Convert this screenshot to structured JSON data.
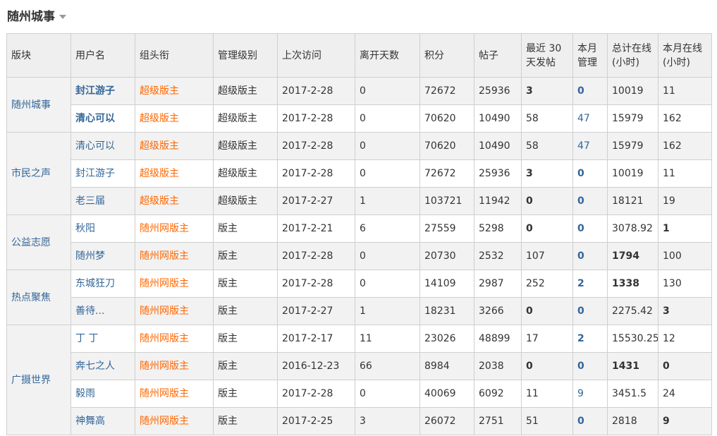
{
  "page": {
    "title": "随州城事"
  },
  "table": {
    "headers": [
      "版块",
      "用户名",
      "组头衔",
      "管理级别",
      "上次访问",
      "离开天数",
      "积分",
      "帖子",
      "最近 30 天发帖",
      "本月管理",
      "总计在线(小时)",
      "本月在线(小时)"
    ],
    "header_lines": [
      [
        "版块"
      ],
      [
        "用户名"
      ],
      [
        "组头衔"
      ],
      [
        "管理级别"
      ],
      [
        "上次访问"
      ],
      [
        "离开天数"
      ],
      [
        "积分"
      ],
      [
        "帖子"
      ],
      [
        "最近 30",
        "天发帖"
      ],
      [
        "本月",
        "管理"
      ],
      [
        "总计在线",
        "(小时)"
      ],
      [
        "本月在线",
        "(小时)"
      ]
    ],
    "groups": [
      {
        "forum": "随州城事",
        "rows": [
          {
            "user": "封江游子",
            "user_bold": true,
            "title": "超级版主",
            "level": "超级版主",
            "last": "2017-2-28",
            "away": "0",
            "points": "72672",
            "posts": "25936",
            "recent": "3",
            "recent_bold": true,
            "manage": "0",
            "manage_bold": true,
            "total": "10019",
            "total_bold": false,
            "month": "11",
            "month_bold": false
          },
          {
            "user": "清心可以",
            "user_bold": true,
            "title": "超级版主",
            "level": "超级版主",
            "last": "2017-2-28",
            "away": "0",
            "points": "70620",
            "posts": "10490",
            "recent": "58",
            "recent_bold": false,
            "manage": "47",
            "manage_bold": false,
            "total": "15979",
            "total_bold": false,
            "month": "162",
            "month_bold": false
          }
        ]
      },
      {
        "forum": "市民之声",
        "rows": [
          {
            "user": "清心可以",
            "user_bold": false,
            "title": "超级版主",
            "level": "超级版主",
            "last": "2017-2-28",
            "away": "0",
            "points": "70620",
            "posts": "10490",
            "recent": "58",
            "recent_bold": false,
            "manage": "47",
            "manage_bold": false,
            "total": "15979",
            "total_bold": false,
            "month": "162",
            "month_bold": false
          },
          {
            "user": "封江游子",
            "user_bold": false,
            "title": "超级版主",
            "level": "超级版主",
            "last": "2017-2-28",
            "away": "0",
            "points": "72672",
            "posts": "25936",
            "recent": "3",
            "recent_bold": true,
            "manage": "0",
            "manage_bold": true,
            "total": "10019",
            "total_bold": false,
            "month": "11",
            "month_bold": false
          },
          {
            "user": "老三届",
            "user_bold": false,
            "title": "超级版主",
            "level": "超级版主",
            "last": "2017-2-27",
            "away": "1",
            "points": "103721",
            "posts": "11942",
            "recent": "0",
            "recent_bold": true,
            "manage": "0",
            "manage_bold": true,
            "total": "18121",
            "total_bold": false,
            "month": "19",
            "month_bold": false
          }
        ]
      },
      {
        "forum": "公益志愿",
        "rows": [
          {
            "user": "秋阳",
            "user_bold": false,
            "title": "随州网版主",
            "level": "版主",
            "last": "2017-2-21",
            "away": "6",
            "points": "27559",
            "posts": "5298",
            "recent": "0",
            "recent_bold": true,
            "manage": "0",
            "manage_bold": true,
            "total": "3078.92",
            "total_bold": false,
            "month": "1",
            "month_bold": true
          },
          {
            "user": "随州梦",
            "user_bold": false,
            "title": "随州网版主",
            "level": "版主",
            "last": "2017-2-28",
            "away": "0",
            "points": "20730",
            "posts": "2532",
            "recent": "107",
            "recent_bold": false,
            "manage": "0",
            "manage_bold": true,
            "total": "1794",
            "total_bold": true,
            "month": "100",
            "month_bold": false
          }
        ]
      },
      {
        "forum": "热点聚焦",
        "rows": [
          {
            "user": "东城狂刀",
            "user_bold": false,
            "title": "随州网版主",
            "level": "版主",
            "last": "2017-2-28",
            "away": "0",
            "points": "14109",
            "posts": "2987",
            "recent": "252",
            "recent_bold": false,
            "manage": "2",
            "manage_bold": true,
            "total": "1338",
            "total_bold": true,
            "month": "130",
            "month_bold": false
          },
          {
            "user": "善待...",
            "user_bold": false,
            "title": "随州网版主",
            "level": "版主",
            "last": "2017-2-27",
            "away": "1",
            "points": "18231",
            "posts": "3266",
            "recent": "0",
            "recent_bold": true,
            "manage": "0",
            "manage_bold": true,
            "total": "2275.42",
            "total_bold": false,
            "month": "3",
            "month_bold": true
          }
        ]
      },
      {
        "forum": "广摄世界",
        "rows": [
          {
            "user": "丁 丁",
            "user_bold": false,
            "title": "随州网版主",
            "level": "版主",
            "last": "2017-2-17",
            "away": "11",
            "points": "23026",
            "posts": "48899",
            "recent": "17",
            "recent_bold": false,
            "manage": "2",
            "manage_bold": true,
            "total": "15530.25",
            "total_bold": false,
            "month": "12",
            "month_bold": false
          },
          {
            "user": "奔七之人",
            "user_bold": false,
            "title": "随州网版主",
            "level": "版主",
            "last": "2016-12-23",
            "away": "66",
            "points": "8984",
            "posts": "2038",
            "recent": "0",
            "recent_bold": true,
            "manage": "0",
            "manage_bold": true,
            "total": "1431",
            "total_bold": true,
            "month": "0",
            "month_bold": true
          },
          {
            "user": "毅雨",
            "user_bold": false,
            "title": "随州网版主",
            "level": "版主",
            "last": "2017-2-28",
            "away": "0",
            "points": "40069",
            "posts": "6092",
            "recent": "11",
            "recent_bold": false,
            "manage": "9",
            "manage_bold": false,
            "total": "3451.5",
            "total_bold": false,
            "month": "24",
            "month_bold": false
          },
          {
            "user": "神舞高",
            "user_bold": false,
            "title": "随州网版主",
            "level": "版主",
            "last": "2017-2-25",
            "away": "3",
            "points": "26072",
            "posts": "2751",
            "recent": "51",
            "recent_bold": false,
            "manage": "0",
            "manage_bold": true,
            "total": "2818",
            "total_bold": false,
            "month": "9",
            "month_bold": true
          }
        ]
      }
    ]
  },
  "colors": {
    "link": "#336699",
    "group_title": "#ff6600",
    "header_bg": "#efefef",
    "stripe_bg": "#f2f2f2",
    "border": "#cfcfcf"
  },
  "icons": {
    "title_dropdown": "caret-down-icon"
  }
}
